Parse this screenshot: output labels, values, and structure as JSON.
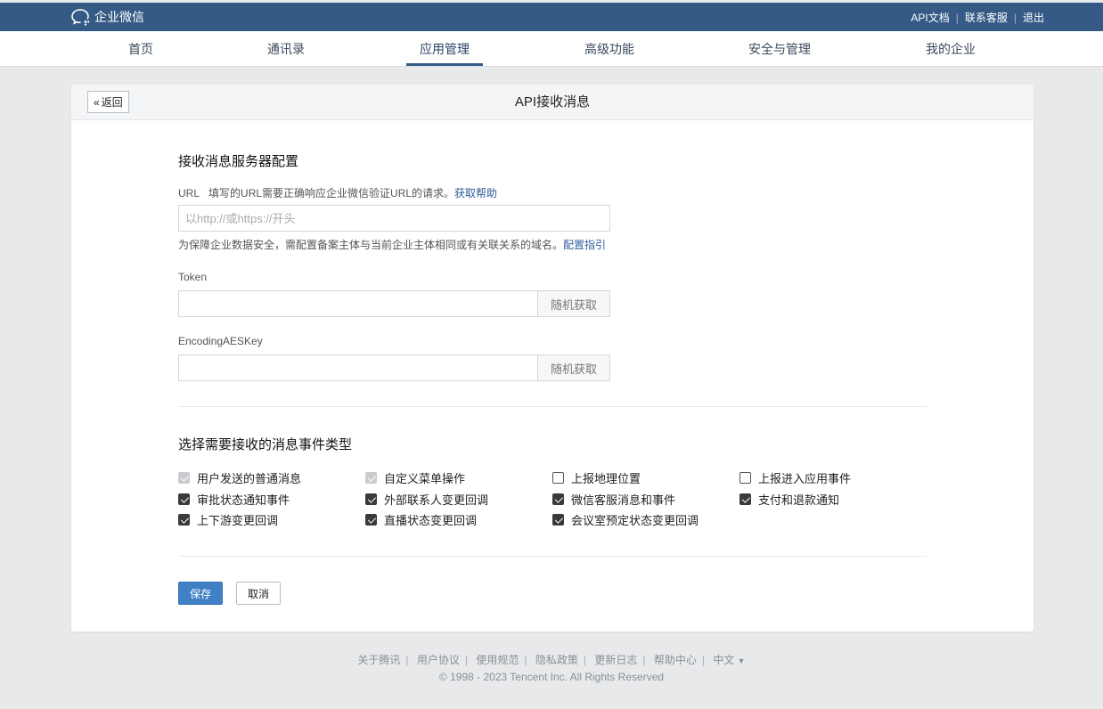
{
  "header": {
    "brand": "企业微信",
    "links": [
      "API文档",
      "联系客服",
      "退出"
    ]
  },
  "nav": {
    "items": [
      "首页",
      "通讯录",
      "应用管理",
      "高级功能",
      "安全与管理",
      "我的企业"
    ],
    "active": "应用管理"
  },
  "page": {
    "back_label": "返回",
    "title": "API接收消息"
  },
  "server_config": {
    "title": "接收消息服务器配置",
    "url_label": "URL",
    "url_desc": "填写的URL需要正确响应企业微信验证URL的请求。",
    "url_help_link": "获取帮助",
    "url_value": "",
    "url_placeholder": "以http://或https://开头",
    "domain_hint": "为保障企业数据安全，需配置备案主体与当前企业主体相同或有关联关系的域名。",
    "domain_hint_link": "配置指引",
    "token_label": "Token",
    "token_value": "",
    "token_random": "随机获取",
    "aes_label": "EncodingAESKey",
    "aes_value": "",
    "aes_random": "随机获取"
  },
  "events": {
    "title": "选择需要接收的消息事件类型",
    "items": [
      {
        "label": "用户发送的普通消息",
        "state": "disabled-checked"
      },
      {
        "label": "自定义菜单操作",
        "state": "disabled-checked"
      },
      {
        "label": "上报地理位置",
        "state": "unchecked"
      },
      {
        "label": "上报进入应用事件",
        "state": "unchecked"
      },
      {
        "label": "审批状态通知事件",
        "state": "checked"
      },
      {
        "label": "外部联系人变更回调",
        "state": "checked"
      },
      {
        "label": "微信客服消息和事件",
        "state": "checked"
      },
      {
        "label": "支付和退款通知",
        "state": "checked"
      },
      {
        "label": "上下游变更回调",
        "state": "checked"
      },
      {
        "label": "直播状态变更回调",
        "state": "checked"
      },
      {
        "label": "会议室预定状态变更回调",
        "state": "checked"
      }
    ]
  },
  "actions": {
    "save": "保存",
    "cancel": "取消"
  },
  "footer": {
    "links": [
      "关于腾讯",
      "用户协议",
      "使用规范",
      "隐私政策",
      "更新日志",
      "帮助中心",
      "中文"
    ],
    "copyright": "© 1998 - 2023 Tencent Inc. All Rights Reserved"
  }
}
